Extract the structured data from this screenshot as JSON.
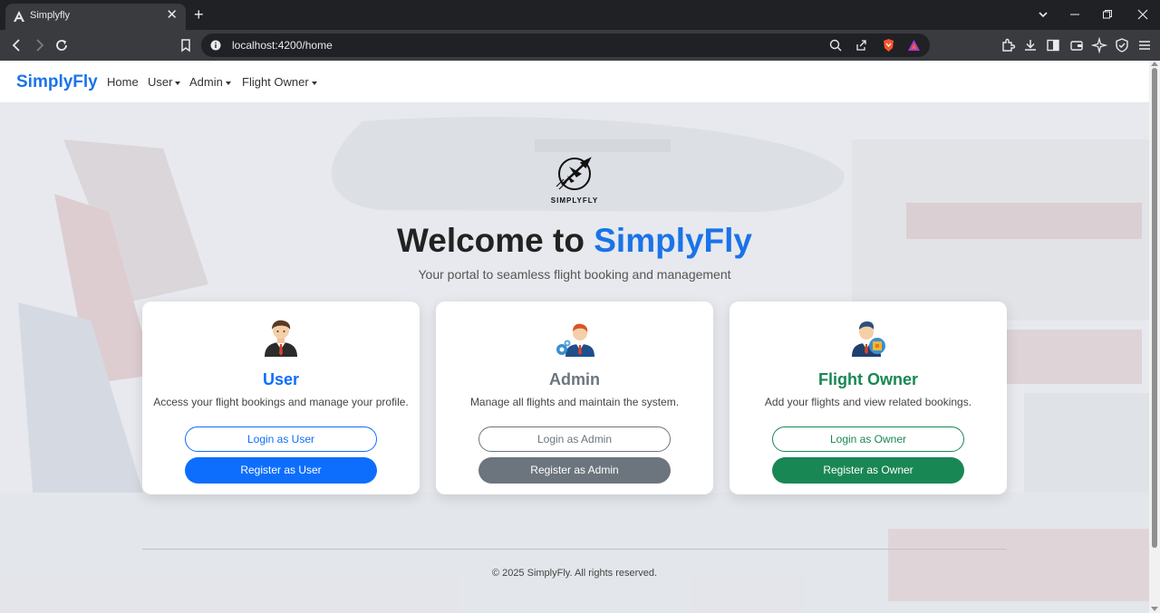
{
  "browser": {
    "tab_title": "Simplyfly",
    "url": "localhost:4200/home",
    "new_tab": "+",
    "close_glyph": "✕"
  },
  "navbar": {
    "brand": "SimplyFly",
    "links": [
      {
        "label": "Home"
      },
      {
        "label": "User"
      },
      {
        "label": "Admin"
      },
      {
        "label": "Flight Owner"
      }
    ]
  },
  "hero": {
    "logo_text": "SIMPLYFLY",
    "title_prefix": "Welcome to ",
    "title_accent": "SimplyFly",
    "subtitle": "Your portal to seamless flight booking and management"
  },
  "cards": [
    {
      "title": "User",
      "description": "Access your flight bookings and manage your profile.",
      "login_label": "Login as User",
      "register_label": "Register as User",
      "color": "#0d6efd",
      "icon": "user-avatar-icon"
    },
    {
      "title": "Admin",
      "description": "Manage all flights and maintain the system.",
      "login_label": "Login as Admin",
      "register_label": "Register as Admin",
      "color": "#6c757d",
      "icon": "admin-avatar-icon"
    },
    {
      "title": "Flight Owner",
      "description": "Add your flights and view related bookings.",
      "login_label": "Login as Owner",
      "register_label": "Register as Owner",
      "color": "#198754",
      "icon": "owner-avatar-icon"
    }
  ],
  "footer": {
    "text": "© 2025 SimplyFly. All rights reserved."
  },
  "colors": {
    "brand": "#1a73e8",
    "chrome_dark": "#202124",
    "chrome_toolbar": "#3a3b3e"
  }
}
